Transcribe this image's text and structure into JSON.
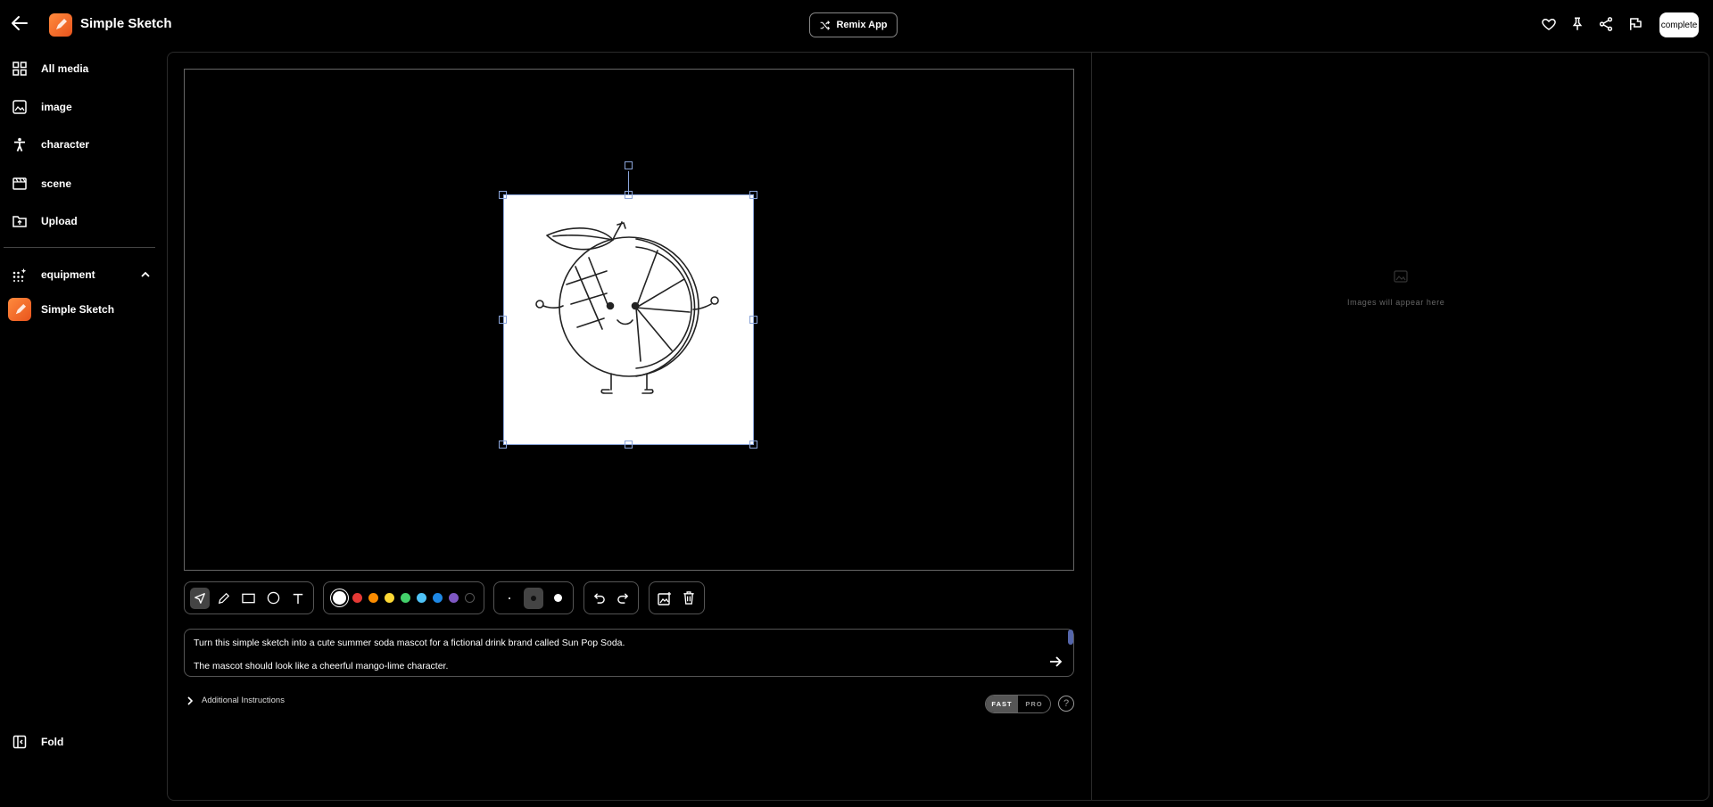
{
  "header": {
    "app_title": "Simple Sketch",
    "remix_label": "Remix App",
    "complete_label": "complete"
  },
  "sidebar": {
    "items": [
      {
        "label": "All media",
        "icon": "grid-icon"
      },
      {
        "label": "image",
        "icon": "image-icon"
      },
      {
        "label": "character",
        "icon": "person-icon"
      },
      {
        "label": "scene",
        "icon": "clapperboard-icon"
      },
      {
        "label": "Upload",
        "icon": "folder-upload-icon"
      }
    ],
    "section": {
      "label": "equipment",
      "expanded": true
    },
    "app_item": {
      "label": "Simple Sketch"
    },
    "fold_label": "Fold"
  },
  "toolbar": {
    "tools": [
      "select",
      "pencil",
      "rectangle",
      "circle",
      "text"
    ],
    "active_tool": "select",
    "colors": [
      "#ffffff",
      "#e53935",
      "#fb8c00",
      "#fdd835",
      "#43d06a",
      "#4fc3f7",
      "#1e88e5",
      "#7e57c2",
      "#000000"
    ],
    "selected_color": "#ffffff",
    "brush_sizes": [
      "small",
      "medium",
      "large"
    ],
    "active_size": "medium"
  },
  "prompt": {
    "line1": "Turn this simple sketch into a cute summer soda mascot for a fictional drink brand called Sun Pop Soda.",
    "line2": "The mascot should look like a cheerful mango-lime character."
  },
  "additional_instructions_label": "Additional Instructions",
  "mode": {
    "fast": "FAST",
    "pro": "PRO",
    "selected": "FAST"
  },
  "help_label": "?",
  "results": {
    "placeholder": "Images will appear here"
  }
}
